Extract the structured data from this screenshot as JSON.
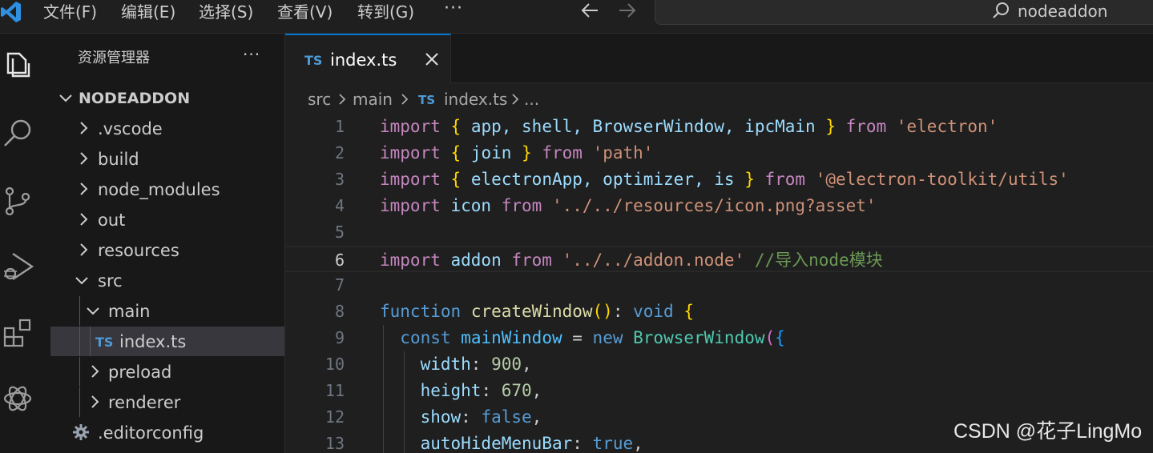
{
  "titlebar": {
    "menus": [
      "文件(F)",
      "编辑(E)",
      "选择(S)",
      "查看(V)",
      "转到(G)"
    ],
    "more": "···",
    "search_text": "nodeaddon"
  },
  "sidebar": {
    "title": "资源管理器",
    "more": "···",
    "tree": [
      {
        "label": "NODEADDON",
        "kind": "root",
        "expanded": true
      },
      {
        "label": ".vscode",
        "kind": "folder",
        "expanded": false
      },
      {
        "label": "build",
        "kind": "folder",
        "expanded": false
      },
      {
        "label": "node_modules",
        "kind": "folder",
        "expanded": false
      },
      {
        "label": "out",
        "kind": "folder",
        "expanded": false
      },
      {
        "label": "resources",
        "kind": "folder",
        "expanded": false
      },
      {
        "label": "src",
        "kind": "folder",
        "expanded": true
      },
      {
        "label": "main",
        "kind": "folder",
        "expanded": true
      },
      {
        "label": "index.ts",
        "kind": "ts-file",
        "selected": true,
        "badge": "TS"
      },
      {
        "label": "preload",
        "kind": "folder",
        "expanded": false
      },
      {
        "label": "renderer",
        "kind": "folder",
        "expanded": false
      },
      {
        "label": ".editorconfig",
        "kind": "config-file"
      }
    ]
  },
  "tab": {
    "badge": "TS",
    "label": "index.ts"
  },
  "breadcrumb": {
    "parts": [
      "src",
      "main",
      "index.ts",
      "..."
    ],
    "badge": "TS"
  },
  "editor": {
    "current_line": 6,
    "lines": [
      {
        "n": "1",
        "tokens": [
          [
            "import",
            "kw"
          ],
          [
            " ",
            "p"
          ],
          [
            "{",
            "br1"
          ],
          [
            " app, shell, BrowserWindow, ipcMain ",
            "id"
          ],
          [
            "}",
            "br1"
          ],
          [
            " ",
            "p"
          ],
          [
            "from",
            "kw"
          ],
          [
            " ",
            "p"
          ],
          [
            "'electron'",
            "str"
          ]
        ]
      },
      {
        "n": "2",
        "tokens": [
          [
            "import",
            "kw"
          ],
          [
            " ",
            "p"
          ],
          [
            "{",
            "br1"
          ],
          [
            " join ",
            "id"
          ],
          [
            "}",
            "br1"
          ],
          [
            " ",
            "p"
          ],
          [
            "from",
            "kw"
          ],
          [
            " ",
            "p"
          ],
          [
            "'path'",
            "str"
          ]
        ]
      },
      {
        "n": "3",
        "tokens": [
          [
            "import",
            "kw"
          ],
          [
            " ",
            "p"
          ],
          [
            "{",
            "br1"
          ],
          [
            " electronApp, optimizer, is ",
            "id"
          ],
          [
            "}",
            "br1"
          ],
          [
            " ",
            "p"
          ],
          [
            "from",
            "kw"
          ],
          [
            " ",
            "p"
          ],
          [
            "'@electron-toolkit/utils'",
            "str"
          ]
        ]
      },
      {
        "n": "4",
        "tokens": [
          [
            "import",
            "kw"
          ],
          [
            " icon ",
            "id"
          ],
          [
            "from",
            "kw"
          ],
          [
            " ",
            "p"
          ],
          [
            "'../../resources/icon.png?asset'",
            "str"
          ]
        ]
      },
      {
        "n": "5",
        "tokens": []
      },
      {
        "n": "6",
        "tokens": [
          [
            "import",
            "kw"
          ],
          [
            " addon ",
            "id"
          ],
          [
            "from",
            "kw"
          ],
          [
            " ",
            "p"
          ],
          [
            "'../../addon.node'",
            "str"
          ],
          [
            " ",
            "p"
          ],
          [
            "//导入node模块",
            "cmt"
          ]
        ]
      },
      {
        "n": "7",
        "tokens": []
      },
      {
        "n": "8",
        "tokens": [
          [
            "function",
            "decl"
          ],
          [
            " ",
            "p"
          ],
          [
            "createWindow",
            "fn"
          ],
          [
            "()",
            "br1"
          ],
          [
            ": ",
            "p"
          ],
          [
            "void",
            "decl"
          ],
          [
            " ",
            "p"
          ],
          [
            "{",
            "br1"
          ]
        ]
      },
      {
        "n": "9",
        "tokens": [
          [
            "  ",
            "p"
          ],
          [
            "const",
            "decl"
          ],
          [
            " ",
            "p"
          ],
          [
            "mainWindow",
            "const"
          ],
          [
            " = ",
            "p"
          ],
          [
            "new",
            "decl"
          ],
          [
            " ",
            "p"
          ],
          [
            "BrowserWindow",
            "cls"
          ],
          [
            "(",
            "br2"
          ],
          [
            "{",
            "br3"
          ]
        ]
      },
      {
        "n": "10",
        "tokens": [
          [
            "    ",
            "p"
          ],
          [
            "width",
            "id"
          ],
          [
            ": ",
            "p"
          ],
          [
            "900",
            "num"
          ],
          [
            ",",
            "p"
          ]
        ]
      },
      {
        "n": "11",
        "tokens": [
          [
            "    ",
            "p"
          ],
          [
            "height",
            "id"
          ],
          [
            ": ",
            "p"
          ],
          [
            "670",
            "num"
          ],
          [
            ",",
            "p"
          ]
        ]
      },
      {
        "n": "12",
        "tokens": [
          [
            "    ",
            "p"
          ],
          [
            "show",
            "id"
          ],
          [
            ": ",
            "p"
          ],
          [
            "false",
            "decl"
          ],
          [
            ",",
            "p"
          ]
        ]
      },
      {
        "n": "13",
        "tokens": [
          [
            "    ",
            "p"
          ],
          [
            "autoHideMenuBar",
            "id"
          ],
          [
            ": ",
            "p"
          ],
          [
            "true",
            "decl"
          ],
          [
            ",",
            "p"
          ]
        ]
      }
    ]
  },
  "colors": {
    "kw": "#c586c0",
    "decl": "#569cd6",
    "id": "#9cdcfe",
    "str": "#ce9178",
    "cmt": "#6a9955",
    "fn": "#dcdcaa",
    "cls": "#4ec9b0",
    "num": "#b5cea8",
    "const": "#4fc1ff",
    "br1": "#ffd700",
    "br2": "#da70d6",
    "br3": "#179fff",
    "p": "#cccccc"
  },
  "watermark": "CSDN @花子LingMo"
}
